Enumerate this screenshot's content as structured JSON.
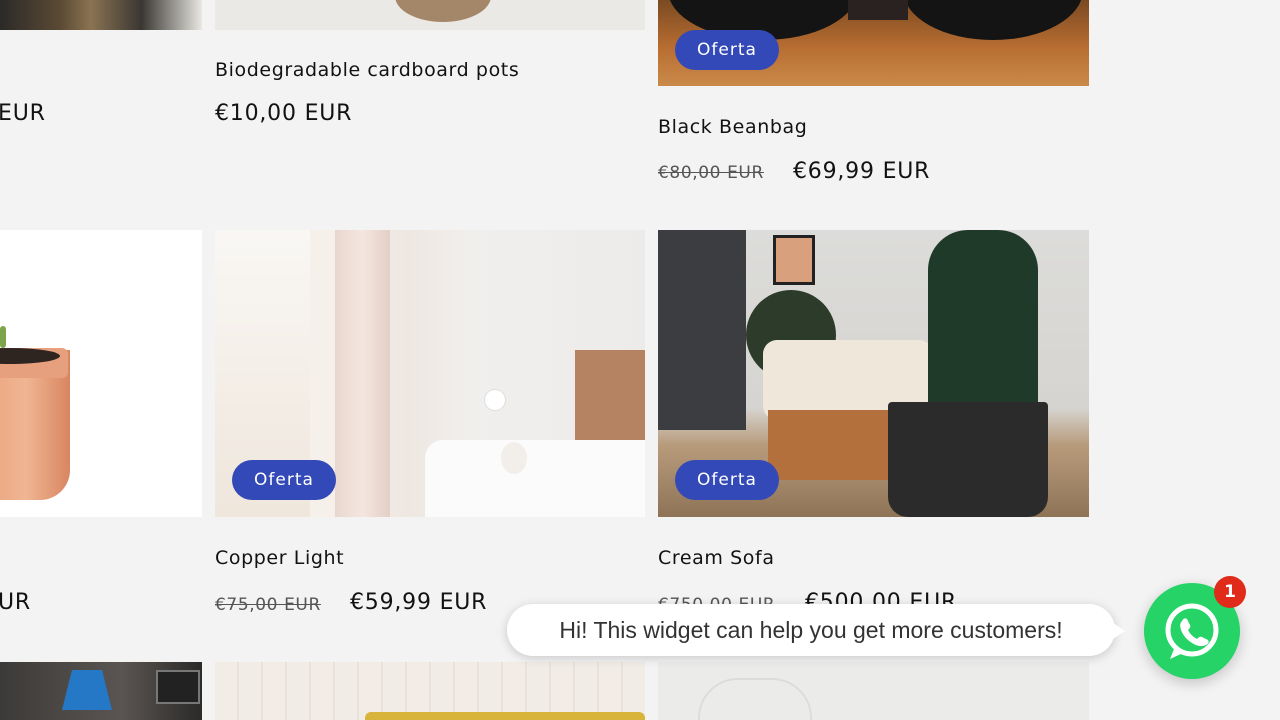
{
  "products": [
    {
      "title": "",
      "price": "EUR"
    },
    {
      "title": "Biodegradable cardboard pots",
      "price": "€10,00 EUR"
    },
    {
      "title": "Black Beanbag",
      "old_price": "€80,00 EUR",
      "price": "€69,99 EUR",
      "badge": "Oferta"
    },
    {
      "title": "",
      "price": "UR"
    },
    {
      "title": "Copper Light",
      "old_price": "€75,00 EUR",
      "price": "€59,99 EUR",
      "badge": "Oferta"
    },
    {
      "title": "Cream Sofa",
      "old_price": "€750,00 EUR",
      "price": "€500,00 EUR",
      "badge": "Oferta"
    }
  ],
  "chat": {
    "message": "Hi! This widget can help you get more customers!",
    "unread": "1"
  },
  "colors": {
    "badge": "#3349b8",
    "whatsapp": "#25d366",
    "notification": "#e02b1b"
  }
}
